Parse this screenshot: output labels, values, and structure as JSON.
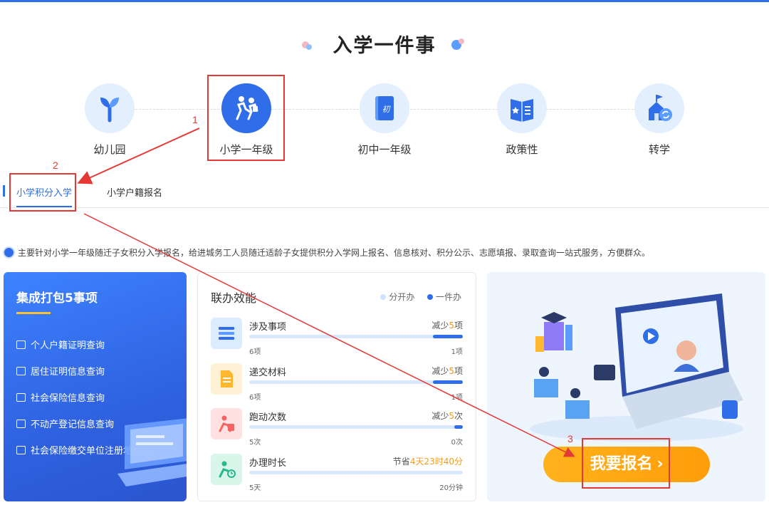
{
  "page": {
    "title": "入学一件事"
  },
  "stages": [
    {
      "label": "幼儿园",
      "icon": "sprout-icon",
      "active": false
    },
    {
      "label": "小学一年级",
      "icon": "running-kids-icon",
      "active": true
    },
    {
      "label": "初中一年级",
      "icon": "junior-book-icon",
      "active": false
    },
    {
      "label": "政策性",
      "icon": "policy-book-icon",
      "active": false
    },
    {
      "label": "转学",
      "icon": "transfer-school-icon",
      "active": false
    }
  ],
  "tabs": [
    {
      "label": "小学积分入学",
      "active": true
    },
    {
      "label": "小学户籍报名",
      "active": false
    }
  ],
  "description": "主要针对小学一年级随迁子女积分入学报名，给进城务工人员随迁适龄子女提供积分入学网上报名、信息核对、积分公示、志愿填报、录取查询一站式服务，方便群众。",
  "bundle": {
    "title": "集成打包5事项",
    "items": [
      "个人户籍证明查询",
      "居住证明信息查询",
      "社会保险信息查询",
      "不动产登记信息查询",
      "社会保险缴交单位注册地查询"
    ]
  },
  "efficiency": {
    "title": "联办效能",
    "legend": {
      "separate": "分开办",
      "combined": "一件办"
    },
    "rows": [
      {
        "name": "涉及事项",
        "right_prefix": "减少",
        "right_value": "5",
        "right_suffix": "项",
        "before": "6项",
        "after": "1项",
        "after_ratio": 0.14,
        "icon": "list-icon"
      },
      {
        "name": "递交材料",
        "right_prefix": "减少",
        "right_value": "5",
        "right_suffix": "项",
        "before": "6项",
        "after": "1项",
        "after_ratio": 0.14,
        "icon": "document-icon"
      },
      {
        "name": "跑动次数",
        "right_prefix": "减少",
        "right_value": "5",
        "right_suffix": "次",
        "before": "5次",
        "after": "0次",
        "after_ratio": 0.04,
        "icon": "running-person-icon"
      },
      {
        "name": "办理时长",
        "right_prefix": "节省",
        "right_value": "4天23时40分",
        "right_suffix": "",
        "before": "5天",
        "after": "20分钟",
        "after_ratio": 0.0,
        "icon": "clock-person-icon"
      }
    ]
  },
  "cta": {
    "label": "我要报名"
  },
  "annotations": {
    "n1": "1",
    "n2": "2",
    "n3": "3"
  },
  "colors": {
    "primary": "#2f6ee8",
    "accent": "#ff9d0a",
    "highlight": "#f29b1c",
    "annotation": "#e53935"
  }
}
